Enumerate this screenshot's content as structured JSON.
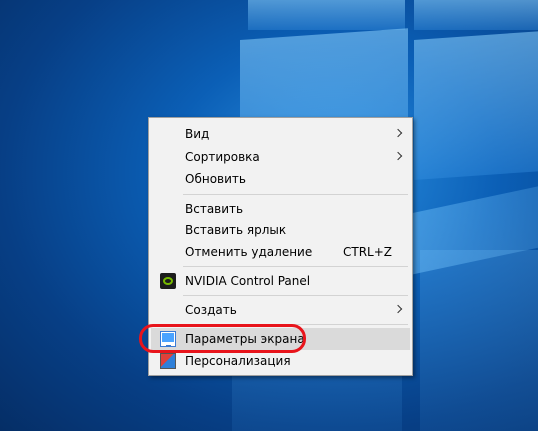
{
  "menu": {
    "view": "Вид",
    "sort": "Сортировка",
    "refresh": "Обновить",
    "paste": "Вставить",
    "paste_shortcut": "Вставить ярлык",
    "undo_delete": "Отменить удаление",
    "undo_delete_shortcut": "CTRL+Z",
    "nvidia": "NVIDIA Control Panel",
    "create": "Создать",
    "display_settings": "Параметры экрана",
    "personalize": "Персонализация"
  },
  "icons": {
    "nvidia": "nvidia-icon",
    "display_settings": "monitor-icon",
    "personalize": "personalize-icon",
    "submenu": "chevron-right-icon"
  },
  "colors": {
    "highlight_ring": "#e8141b",
    "menu_background": "#f2f2f2",
    "desktop_blue": "#0b5fb6"
  }
}
